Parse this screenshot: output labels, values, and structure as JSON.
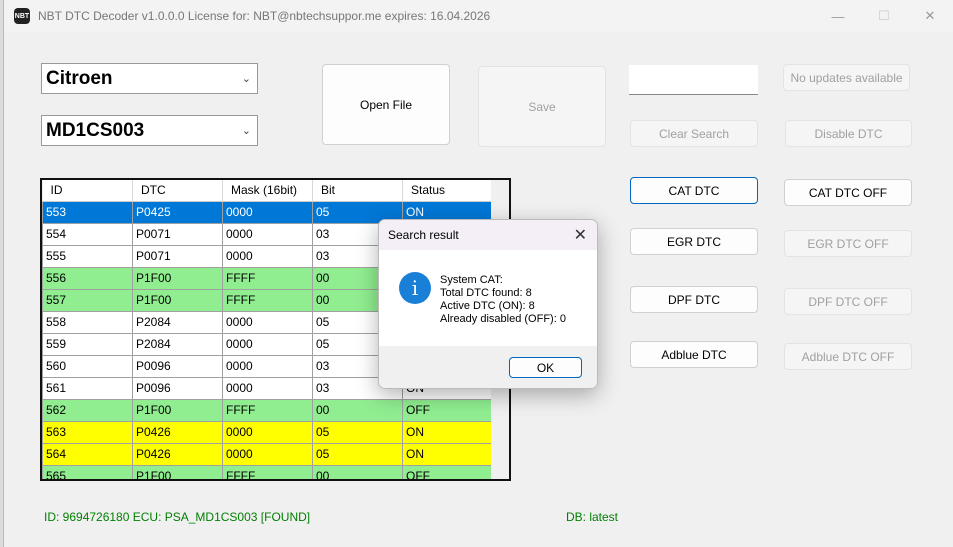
{
  "window": {
    "title": "NBT DTC Decoder v1.0.0.0  License for: NBT@nbtechsuppor.me expires: 16.04.2026",
    "icon_text": "NBT",
    "minimize": "—",
    "maximize": "☐",
    "close": "✕"
  },
  "brand_select": {
    "value": "Citroen"
  },
  "ecu_select": {
    "value": "MD1CS003"
  },
  "buttons": {
    "open_file": "Open File",
    "save": "Save",
    "no_updates": "No updates available",
    "clear_search": "Clear Search",
    "disable_dtc": "Disable DTC",
    "cat_dtc": "CAT DTC",
    "cat_dtc_off": "CAT  DTC OFF",
    "egr_dtc": "EGR DTC",
    "egr_dtc_off": "EGR DTC OFF",
    "dpf_dtc": "DPF DTC",
    "dpf_dtc_off": "DPF DTC OFF",
    "adblue_dtc": "Adblue DTC",
    "adblue_dtc_off": "Adblue DTC OFF"
  },
  "search": {
    "value": ""
  },
  "table": {
    "columns": [
      "ID",
      "DTC",
      "Mask (16bit)",
      "Bit",
      "Status"
    ],
    "rows": [
      {
        "id": "553",
        "dtc": "P0425",
        "mask": "0000",
        "bit": "05",
        "status": "ON",
        "style": "selected"
      },
      {
        "id": "554",
        "dtc": "P0071",
        "mask": "0000",
        "bit": "03",
        "status": "",
        "style": "white"
      },
      {
        "id": "555",
        "dtc": "P0071",
        "mask": "0000",
        "bit": "03",
        "status": "",
        "style": "white"
      },
      {
        "id": "556",
        "dtc": "P1F00",
        "mask": "FFFF",
        "bit": "00",
        "status": "",
        "style": "green"
      },
      {
        "id": "557",
        "dtc": "P1F00",
        "mask": "FFFF",
        "bit": "00",
        "status": "",
        "style": "green"
      },
      {
        "id": "558",
        "dtc": "P2084",
        "mask": "0000",
        "bit": "05",
        "status": "",
        "style": "white"
      },
      {
        "id": "559",
        "dtc": "P2084",
        "mask": "0000",
        "bit": "05",
        "status": "",
        "style": "white"
      },
      {
        "id": "560",
        "dtc": "P0096",
        "mask": "0000",
        "bit": "03",
        "status": "",
        "style": "white"
      },
      {
        "id": "561",
        "dtc": "P0096",
        "mask": "0000",
        "bit": "03",
        "status": "ON",
        "style": "white"
      },
      {
        "id": "562",
        "dtc": "P1F00",
        "mask": "FFFF",
        "bit": "00",
        "status": "OFF",
        "style": "green"
      },
      {
        "id": "563",
        "dtc": "P0426",
        "mask": "0000",
        "bit": "05",
        "status": "ON",
        "style": "yellow"
      },
      {
        "id": "564",
        "dtc": "P0426",
        "mask": "0000",
        "bit": "05",
        "status": "ON",
        "style": "yellow"
      },
      {
        "id": "565",
        "dtc": "P1F00",
        "mask": "FFFF",
        "bit": "00",
        "status": "OFF",
        "style": "green"
      }
    ]
  },
  "footer": {
    "ecu_info": "ID: 9694726180 ECU: PSA_MD1CS003 [FOUND]",
    "db": "DB: latest"
  },
  "dialog": {
    "title": "Search result",
    "icon": "info-icon",
    "lines": [
      "System CAT:",
      "Total DTC found: 8",
      "Active DTC (ON): 8",
      "Already disabled (OFF): 0"
    ],
    "ok": "OK",
    "close": "✕"
  },
  "colors": {
    "selected": "#0078d7",
    "green": "#90ee90",
    "yellow": "#ffff00",
    "footer_text": "#008000"
  }
}
